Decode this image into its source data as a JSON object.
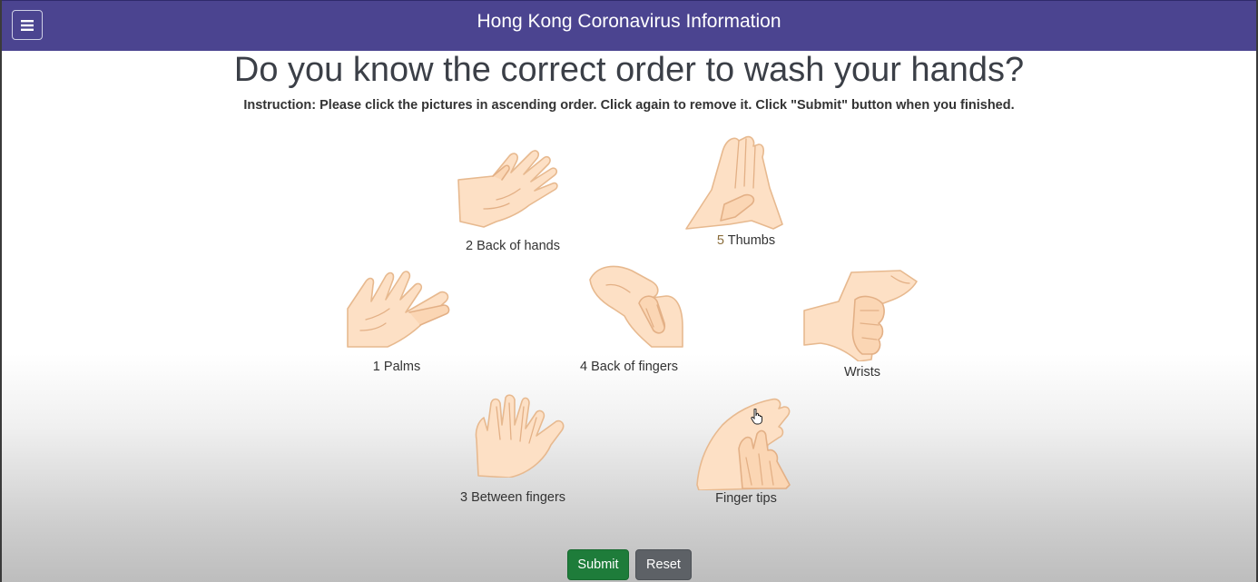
{
  "app": {
    "title": "Hong Kong Coronavirus Information"
  },
  "page": {
    "heading": "Do you know the correct order to wash your hands?",
    "instruction": "Instruction: Please click the pictures in ascending order. Click again to remove it. Click \"Submit\" button when you finished."
  },
  "steps": [
    {
      "number": "2",
      "name": "Back of hands",
      "icon": "back-of-hands-icon"
    },
    {
      "number": "5",
      "name": "Thumbs",
      "icon": "thumbs-icon"
    },
    {
      "number": "1",
      "name": "Palms",
      "icon": "palms-icon"
    },
    {
      "number": "4",
      "name": "Back of fingers",
      "icon": "back-of-fingers-icon"
    },
    {
      "number": "",
      "name": "Wrists",
      "icon": "wrists-icon"
    },
    {
      "number": "3",
      "name": "Between fingers",
      "icon": "between-fingers-icon"
    },
    {
      "number": "",
      "name": "Finger tips",
      "icon": "finger-tips-icon"
    }
  ],
  "buttons": {
    "submit": "Submit",
    "reset": "Reset"
  },
  "menu": {
    "icon": "hamburger-menu-icon"
  },
  "colors": {
    "navbar": "#4b4490",
    "submit": "#1e7c3a",
    "reset": "#5d6166",
    "step_five_number": "#8a6d3b"
  }
}
